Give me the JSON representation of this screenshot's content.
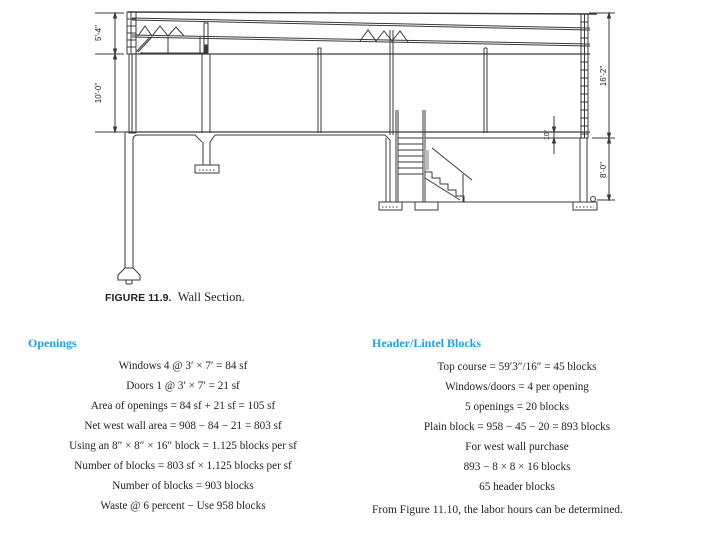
{
  "figure": {
    "label": "FIGURE 11.9.",
    "title": "Wall Section.",
    "dimensions": {
      "left_upper": "5'-4\"",
      "left_lower": "10'-0\"",
      "right_upper": "16'-2\"",
      "right_lower": "8'-0\"",
      "floor_thickness": "10\""
    }
  },
  "openings": {
    "heading": "Openings",
    "lines": [
      "Windows 4 @ 3′ × 7′ = 84 sf",
      "Doors 1 @ 3′ × 7′ = 21 sf",
      "Area of openings = 84 sf + 21 sf = 105 sf",
      "Net west wall area = 908 − 84 − 21 = 803 sf",
      "Using an 8″ × 8″ × 16″ block = 1.125 blocks per sf",
      "Number of blocks = 803 sf × 1.125 blocks per sf",
      "Number of blocks = 903 blocks",
      "Waste @ 6 percent − Use 958 blocks"
    ]
  },
  "header_lintel": {
    "heading": "Header/Lintel Blocks",
    "lines": [
      "Top course = 59′3″/16″ = 45 blocks",
      "Windows/doors = 4 per opening",
      "5 openings = 20 blocks",
      "Plain block = 958 − 45 − 20 = 893 blocks",
      "For west wall purchase",
      "893 − 8 × 8 × 16 blocks",
      "65 header blocks"
    ],
    "footnote": "From Figure 11.10, the labor hours can be determined."
  },
  "colors": {
    "heading": "#1fa2dc",
    "text": "#231f20",
    "drawing": "#3a3a3a"
  }
}
